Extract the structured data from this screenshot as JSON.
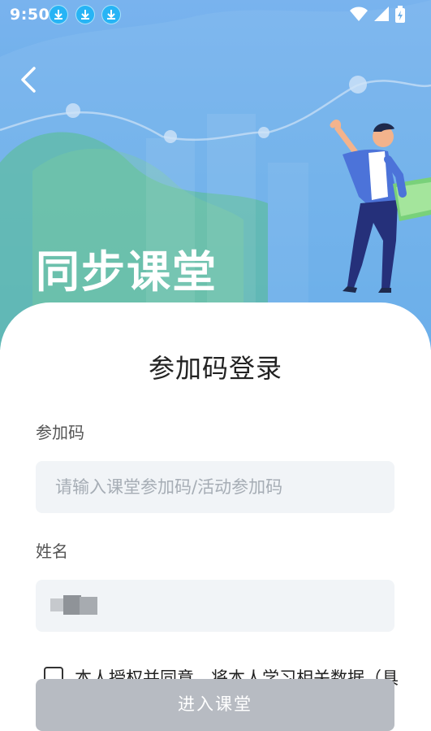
{
  "status_bar": {
    "time": "9:50",
    "download_icons": [
      "download-icon",
      "download-icon",
      "download-icon"
    ],
    "right_icons": [
      "wifi-icon",
      "signal-icon",
      "battery-icon"
    ]
  },
  "header": {
    "back_icon": "chevron-left-icon",
    "app_title": "同步课堂"
  },
  "login": {
    "title": "参加码登录",
    "code_label": "参加码",
    "code_placeholder": "请输入课堂参加码/活动参加码",
    "code_value": "",
    "name_label": "姓名",
    "consent_text": "本人授权并同意，将本人学习相关数据（具",
    "submit_label": "进入课堂"
  },
  "colors": {
    "hero_blue": "#6aaee9",
    "input_bg": "#f1f4f7",
    "button_disabled": "#b7bbc2",
    "download_badge": "#27b4f5"
  }
}
